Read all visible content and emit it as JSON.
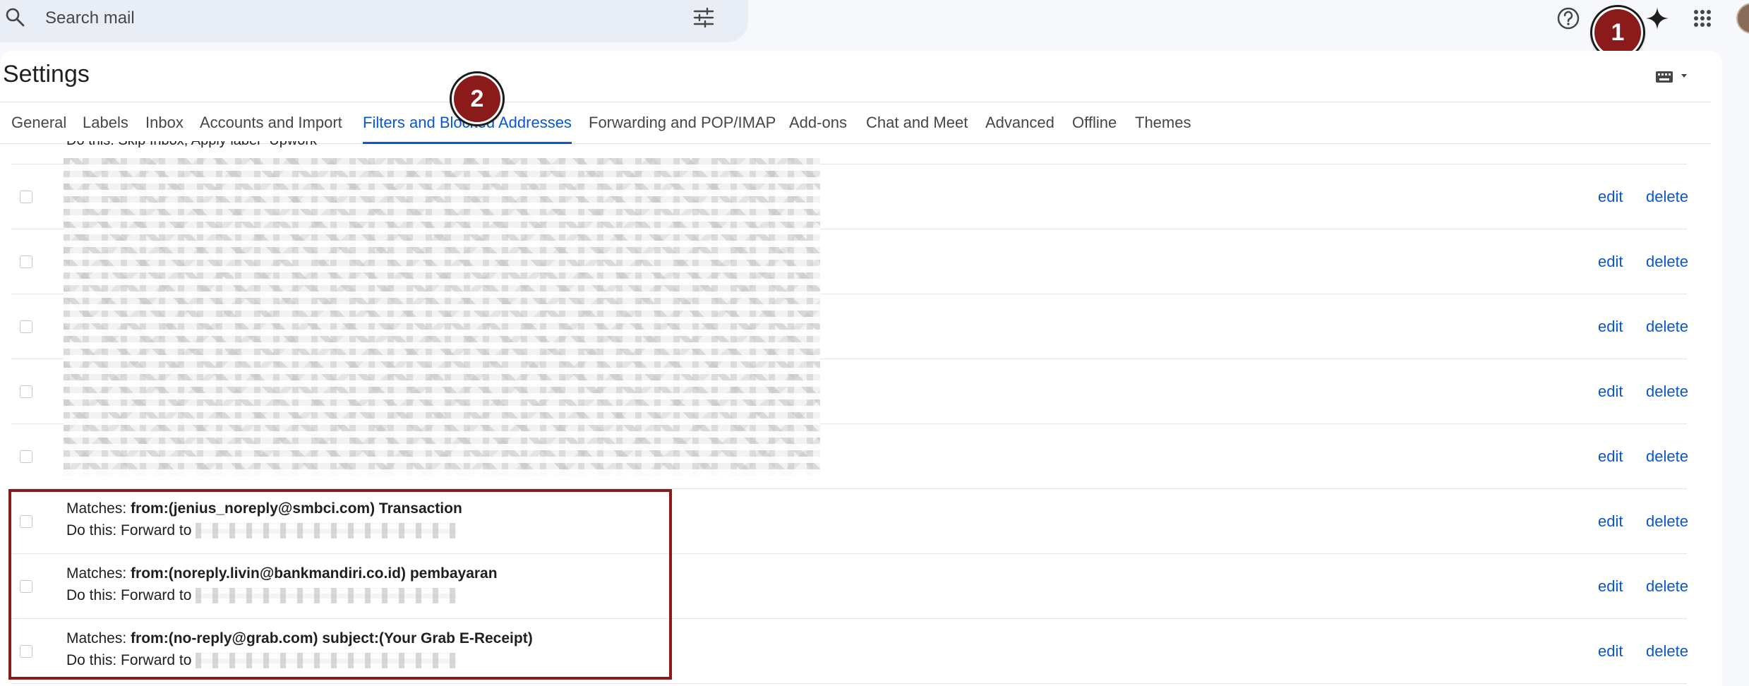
{
  "search": {
    "placeholder": "Search mail"
  },
  "markers": {
    "one": "1",
    "two": "2"
  },
  "page": {
    "title": "Settings"
  },
  "tabs": [
    {
      "label": "General"
    },
    {
      "label": "Labels"
    },
    {
      "label": "Inbox"
    },
    {
      "label": "Accounts and Import"
    },
    {
      "label": "Filters and Blocked Addresses"
    },
    {
      "label": "Forwarding and POP/IMAP"
    },
    {
      "label": "Add-ons"
    },
    {
      "label": "Chat and Meet"
    },
    {
      "label": "Advanced"
    },
    {
      "label": "Offline"
    },
    {
      "label": "Themes"
    }
  ],
  "active_tab": "Filters and Blocked Addresses",
  "clipped_text": "Do this: Skip Inbox, Apply label \"Upwork\"",
  "filters": [
    {
      "edit": "edit",
      "delete": "delete"
    },
    {
      "edit": "edit",
      "delete": "delete"
    },
    {
      "edit": "edit",
      "delete": "delete"
    },
    {
      "edit": "edit",
      "delete": "delete"
    },
    {
      "edit": "edit",
      "delete": "delete"
    },
    {
      "prefix": "Matches: ",
      "criteria": "from:(jenius_noreply@smbci.com) Transaction",
      "action": "Do this: Forward to",
      "edit": "edit",
      "delete": "delete"
    },
    {
      "prefix": "Matches: ",
      "criteria": "from:(noreply.livin@bankmandiri.co.id) pembayaran",
      "action": "Do this: Forward to",
      "edit": "edit",
      "delete": "delete"
    },
    {
      "prefix": "Matches: ",
      "criteria": "from:(no-reply@grab.com) subject:(Your Grab E-Receipt)",
      "action": "Do this: Forward to",
      "edit": "edit",
      "delete": "delete"
    }
  ],
  "colors": {
    "accent": "#0b57d0",
    "marker": "#8b1a1a",
    "highlight": "#8b1a1a"
  },
  "icons": [
    "search-icon",
    "tune-icon",
    "help-icon",
    "gemini-sparkle-icon",
    "apps-grid-icon",
    "keyboard-icon"
  ]
}
